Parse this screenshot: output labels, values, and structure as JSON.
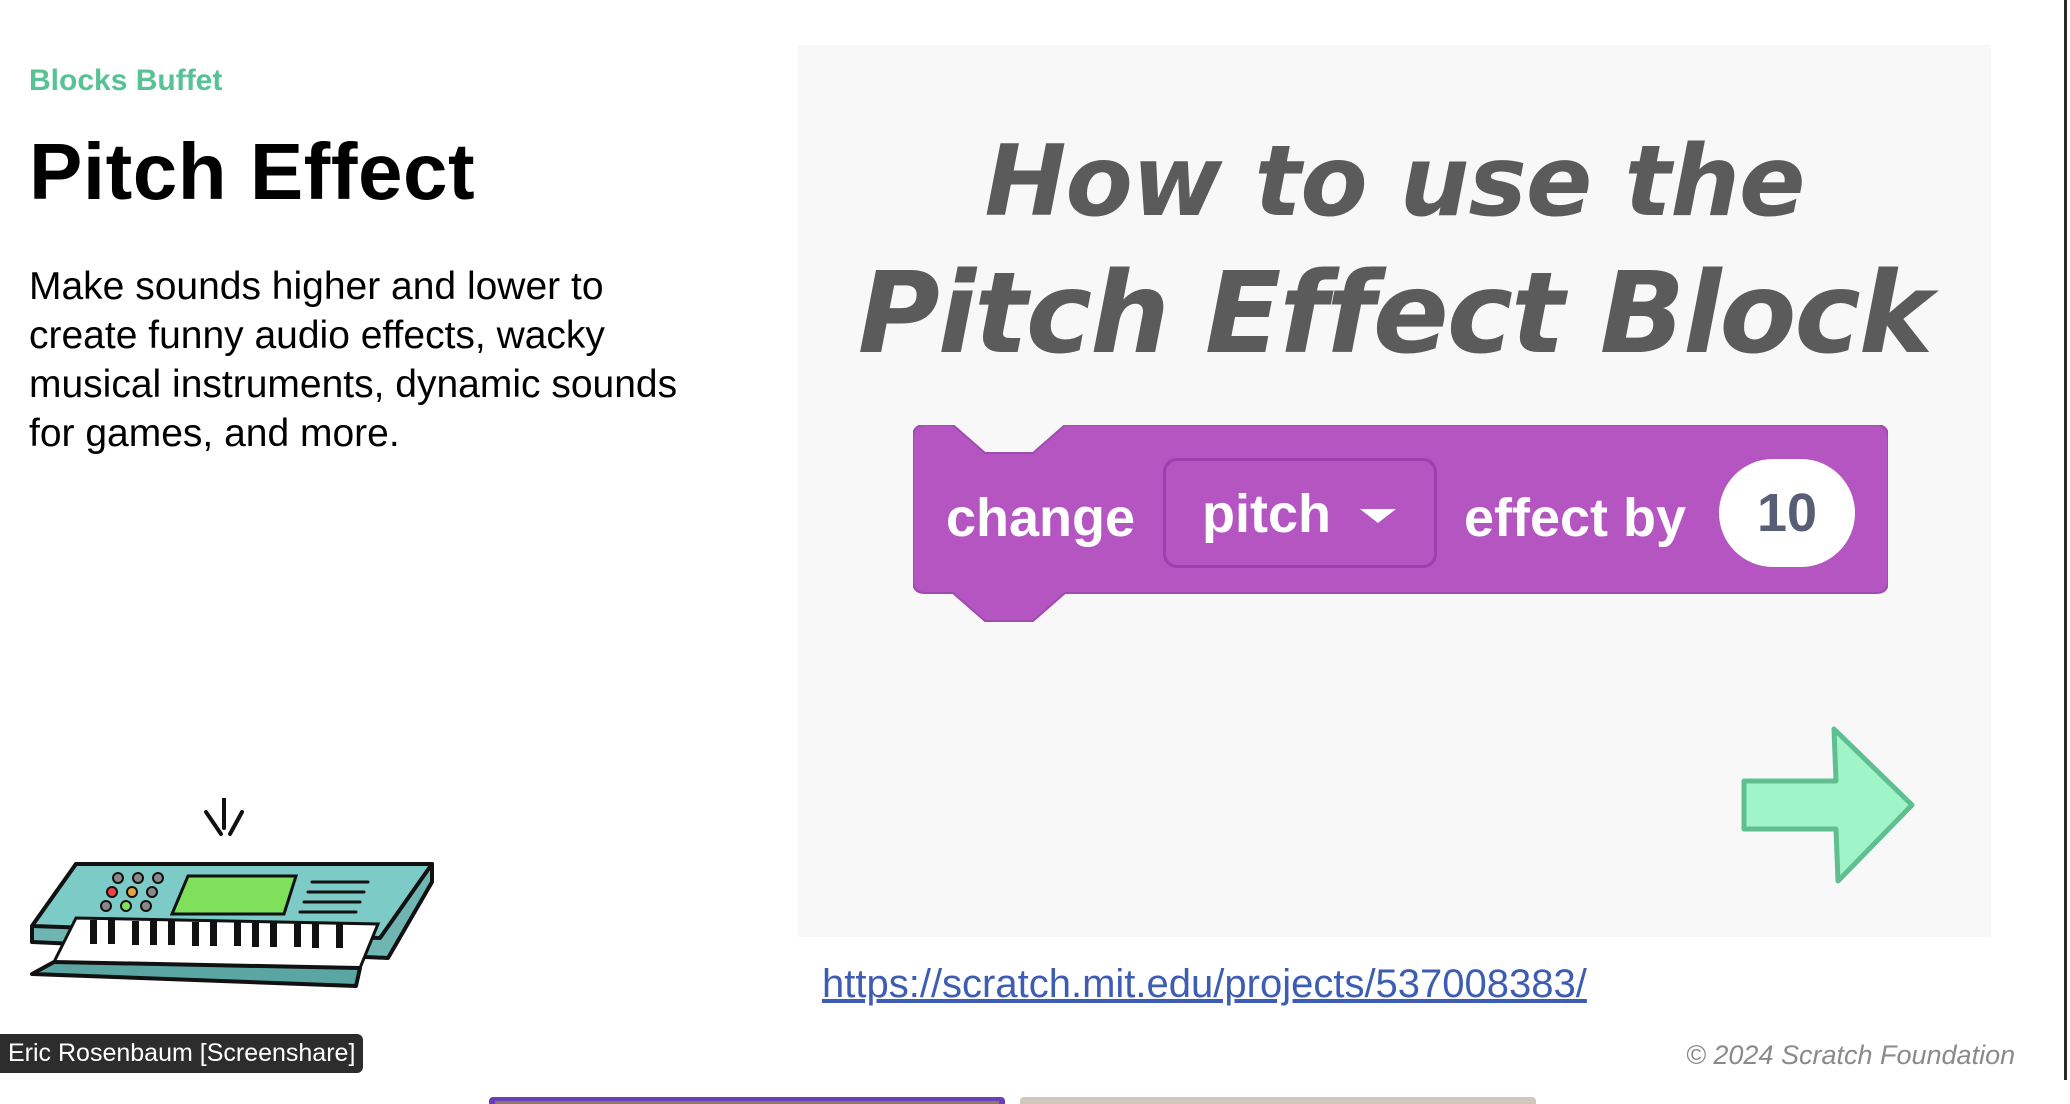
{
  "slide": {
    "eyebrow": "Blocks Buffet",
    "title": "Pitch Effect",
    "description": "Make sounds higher and lower to create funny audio effects, wacky musical instruments, dynamic sounds for games, and more."
  },
  "video": {
    "title_line_1": "How to use the",
    "title_line_2": "Pitch Effect Block",
    "block": {
      "label_change": "change",
      "dropdown_value": "pitch",
      "label_effect": "effect by",
      "number_value": "10",
      "color": "#b455c2"
    },
    "next_icon": "right-arrow-icon",
    "next_color": "#9ff5c8"
  },
  "link": {
    "text": "https://scratch.mit.edu/projects/537008383/"
  },
  "footer": {
    "copyright": "© 2024 Scratch Foundation"
  },
  "meeting": {
    "screenshare_label": "Eric Rosenbaum [Screenshare]"
  },
  "colors": {
    "accent": "#57c293",
    "link": "#3d5db5",
    "block_purple": "#b455c2"
  }
}
